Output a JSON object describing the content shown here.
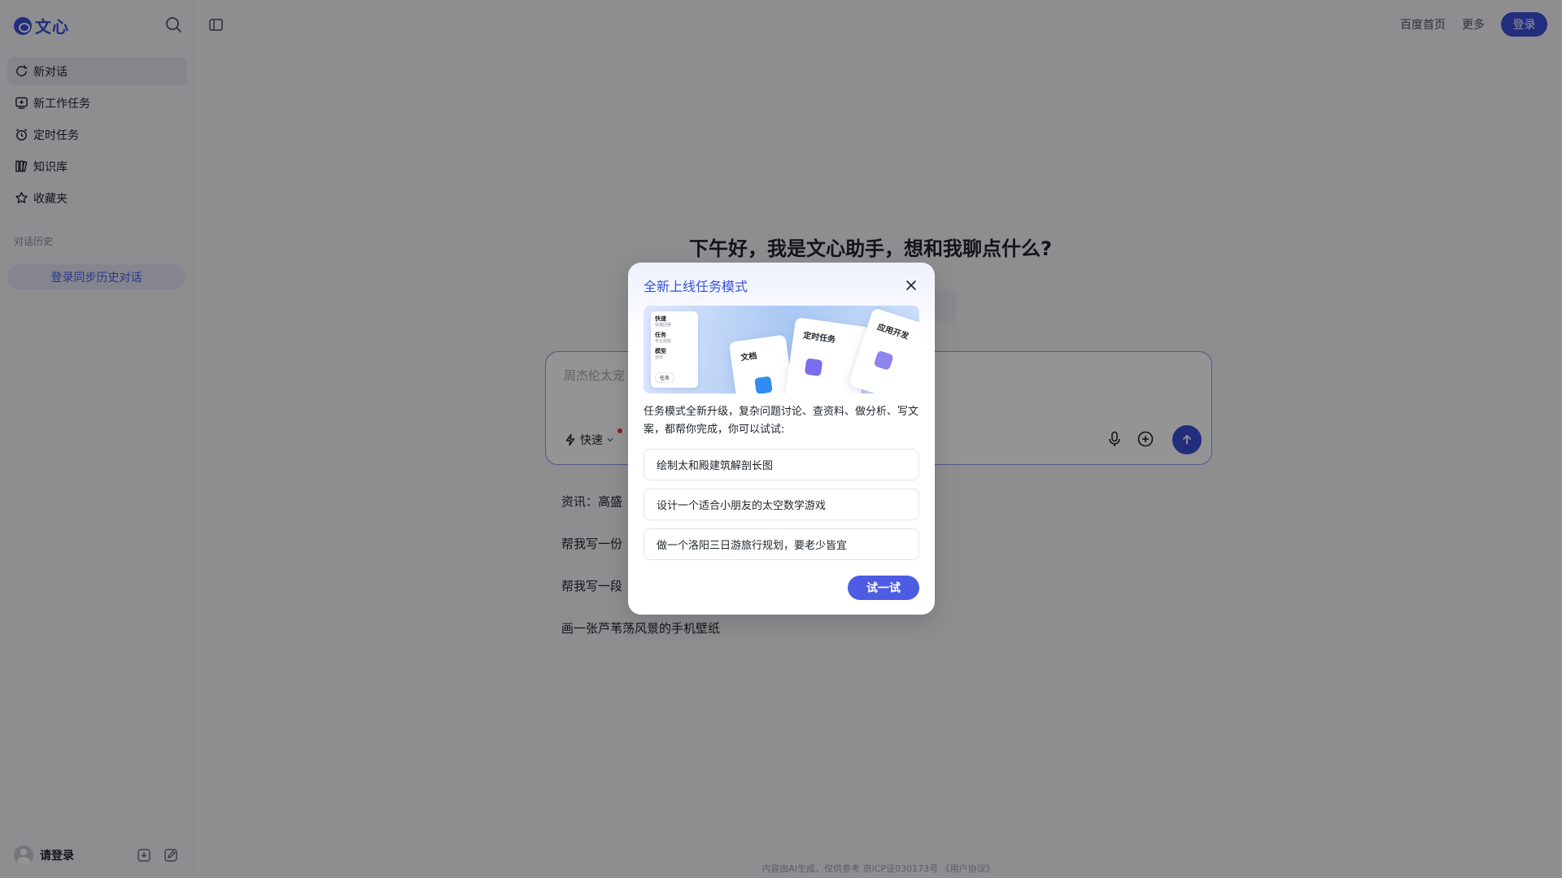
{
  "app": {
    "logo_text": "文心"
  },
  "sidebar": {
    "items": [
      {
        "label": "新对话",
        "icon": "new-chat-icon"
      },
      {
        "label": "新工作任务",
        "icon": "new-task-icon"
      },
      {
        "label": "定时任务",
        "icon": "alarm-clock-icon"
      },
      {
        "label": "知识库",
        "icon": "library-icon"
      },
      {
        "label": "收藏夹",
        "icon": "star-icon"
      }
    ],
    "history_title": "对话历史",
    "sync_button": "登录同步历史对话",
    "user_label": "请登录"
  },
  "header": {
    "links": [
      "百度首页",
      "更多"
    ],
    "login": "登录"
  },
  "main": {
    "greeting": "下午好，我是文心助手，想和我聊点什么?",
    "input_placeholder": "周杰伦太宠",
    "mode_label": "快速",
    "suggestions": [
      "资讯：高盛",
      "帮我写一份",
      "帮我写一段",
      "画一张芦苇荡风景的手机壁纸"
    ],
    "footer": "内容由AI生成，仅供参考 京ICP证030173号 《用户协议》"
  },
  "modal": {
    "title": "全新上线任务模式",
    "banner": {
      "panel_rows": [
        {
          "title": "快速",
          "sub": "快速回答"
        },
        {
          "title": "任务",
          "sub": "专业技能"
        },
        {
          "title": "模型",
          "sub": "自动"
        }
      ],
      "panel_tag": "任务",
      "cards": [
        "文档",
        "定时任务",
        "应用开发"
      ]
    },
    "description": "任务模式全新升级，复杂问题讨论、查资料、做分析、写文案，都帮你完成，你可以试试:",
    "options": [
      "绘制太和殿建筑解剖长图",
      "设计一个适合小朋友的太空数学游戏",
      "做一个洛阳三日游旅行规划，要老少皆宜"
    ],
    "try_button": "试一试"
  },
  "colors": {
    "accent": "#3b4fd9",
    "accent_light": "#4d5ce2"
  }
}
